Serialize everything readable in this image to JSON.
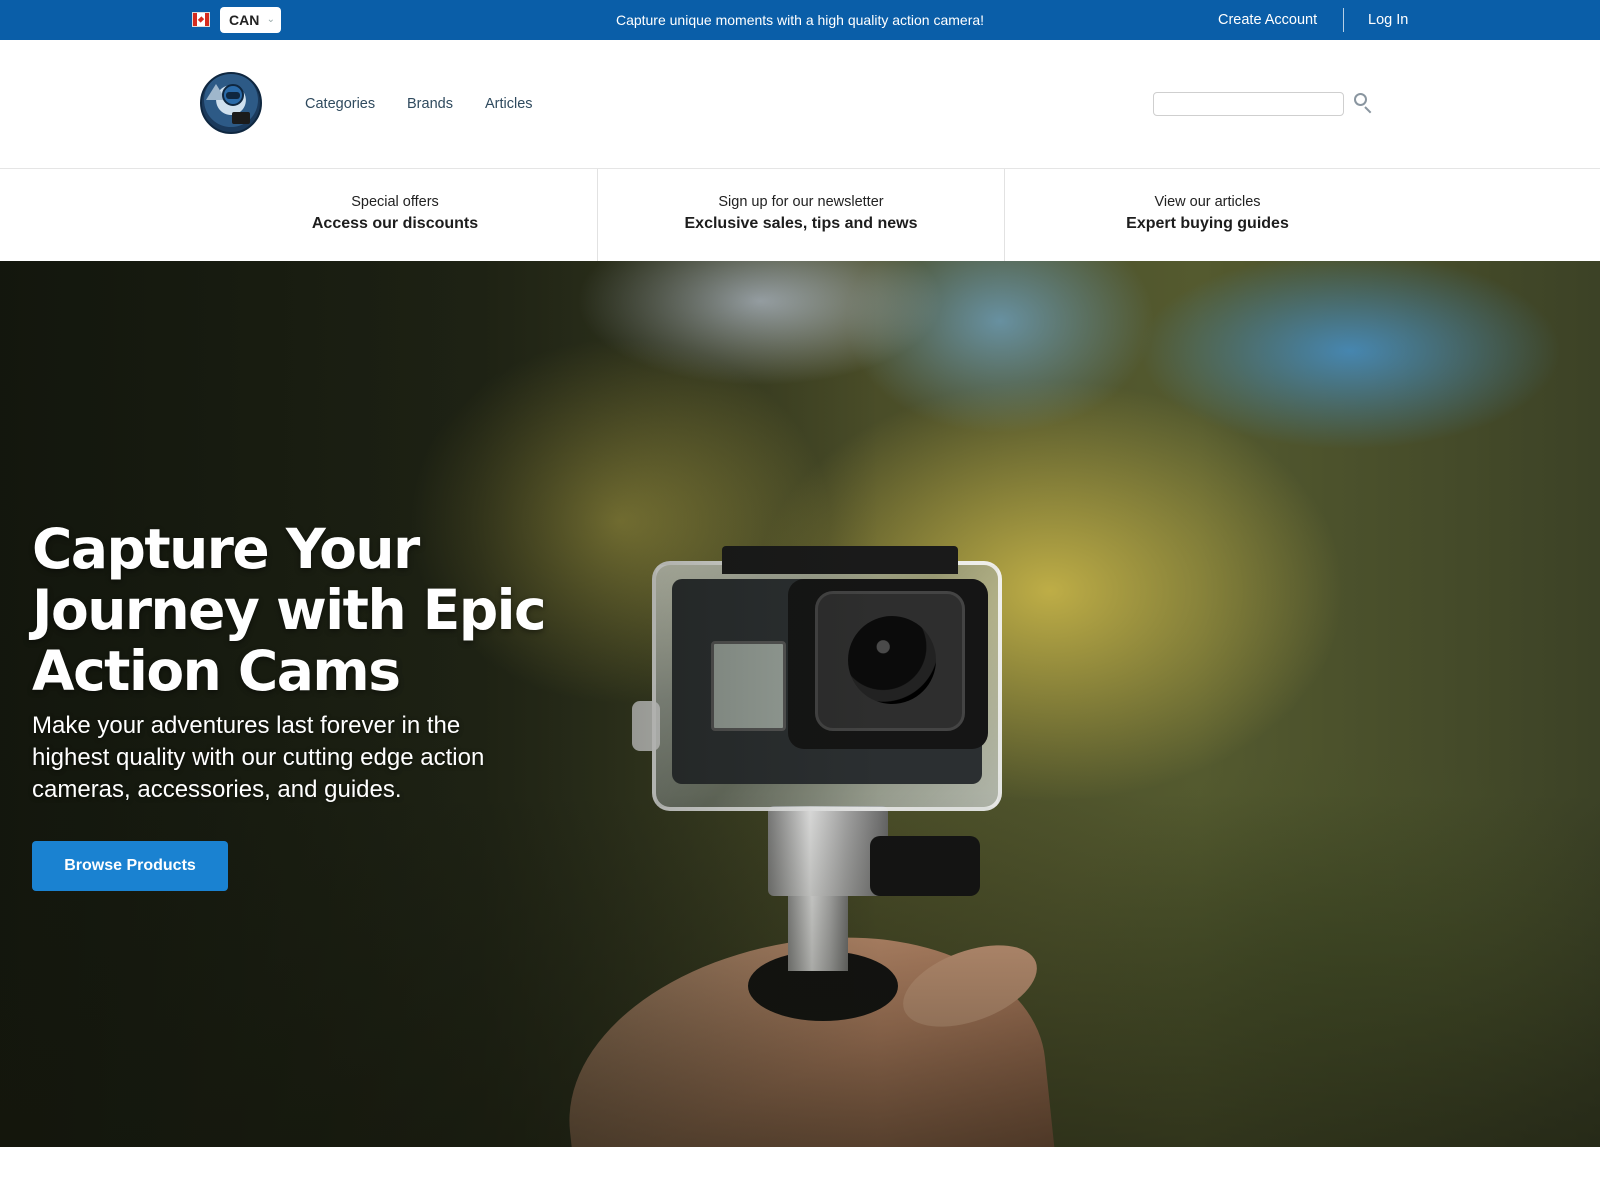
{
  "topbar": {
    "country_code": "CAN",
    "promo_text": "Capture unique moments with a high quality action camera!",
    "create_account": "Create Account",
    "login": "Log In"
  },
  "header": {
    "nav": [
      "Categories",
      "Brands",
      "Articles"
    ],
    "search_placeholder": ""
  },
  "strip": [
    {
      "small": "Special offers",
      "big": "Access our discounts"
    },
    {
      "small": "Sign up for our newsletter",
      "big": "Exclusive sales, tips and news"
    },
    {
      "small": "View our articles",
      "big": "Expert buying guides"
    }
  ],
  "hero": {
    "title": "Capture Your Journey with Epic Action Cams",
    "subtitle": "Make your adventures last forever in the highest quality with our cutting edge action cameras, accessories, and guides.",
    "button": "Browse Products"
  },
  "colors": {
    "topbar_bg": "#0a5ea8",
    "button_bg": "#1a82d1",
    "nav_text": "#2f4a5e"
  },
  "icons": {
    "flag": "canada-flag-icon",
    "dropdown": "chevron-down-icon",
    "search": "search-icon",
    "logo": "astronaut-camera-logo"
  }
}
